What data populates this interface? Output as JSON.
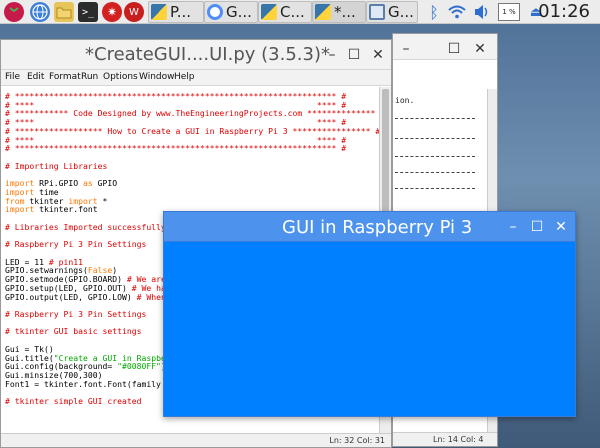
{
  "taskbar": {
    "clock": "01:26",
    "volume": "1 %",
    "buttons": [
      {
        "label": "P..."
      },
      {
        "label": "G..."
      },
      {
        "label": "C..."
      },
      {
        "label": "*..."
      },
      {
        "label": "G..."
      }
    ]
  },
  "editor": {
    "title": "*CreateGUI....UI.py (3.5.3)*",
    "menus": [
      "File",
      "Edit",
      "Format",
      "Run",
      "Options",
      "Window",
      "Help"
    ],
    "status": "Ln: 32   Col: 31",
    "code": [
      [
        {
          "t": "# ****************************************************************** #",
          "c": "cm"
        }
      ],
      [
        {
          "t": "# ****                                                          **** #",
          "c": "cm"
        }
      ],
      [
        {
          "t": "# *********** Code Designed by www.TheEngineeringProjects.com ************** #",
          "c": "cm"
        }
      ],
      [
        {
          "t": "# ****                                                          **** #",
          "c": "cm"
        }
      ],
      [
        {
          "t": "# ****************** How to Create a GUI in Raspberry Pi 3 **************** #",
          "c": "cm"
        }
      ],
      [
        {
          "t": "# ****                                                          **** #",
          "c": "cm"
        }
      ],
      [
        {
          "t": "# ****************************************************************** #",
          "c": "cm"
        }
      ],
      [],
      [
        {
          "t": "# Importing Libraries",
          "c": "cm"
        }
      ],
      [],
      [
        {
          "t": "import",
          "c": "kw"
        },
        {
          "t": " RPi.GPIO "
        },
        {
          "t": "as",
          "c": "kw"
        },
        {
          "t": " GPIO"
        }
      ],
      [
        {
          "t": "import",
          "c": "kw"
        },
        {
          "t": " time"
        }
      ],
      [
        {
          "t": "from",
          "c": "kw"
        },
        {
          "t": " tkinter "
        },
        {
          "t": "import",
          "c": "kw"
        },
        {
          "t": " *"
        }
      ],
      [
        {
          "t": "import",
          "c": "kw"
        },
        {
          "t": " tkinter.font"
        }
      ],
      [],
      [
        {
          "t": "# Libraries Imported successfully",
          "c": "cm"
        }
      ],
      [],
      [
        {
          "t": "# Raspberry Pi 3 Pin Settings",
          "c": "cm"
        }
      ],
      [],
      [
        {
          "t": "LED = 11 "
        },
        {
          "t": "# pin11",
          "c": "cm"
        }
      ],
      [
        {
          "t": "GPIO.setwarnings("
        },
        {
          "t": "False",
          "c": "kw"
        },
        {
          "t": ")"
        }
      ],
      [
        {
          "t": "GPIO.setmode(GPIO.BOARD) "
        },
        {
          "t": "# We are",
          "c": "cm"
        }
      ],
      [
        {
          "t": "GPIO.setup(LED, GPIO.OUT) "
        },
        {
          "t": "# We hav",
          "c": "cm"
        }
      ],
      [
        {
          "t": "GPIO.output(LED, GPIO.LOW) "
        },
        {
          "t": "# When",
          "c": "cm"
        }
      ],
      [],
      [
        {
          "t": "# Raspberry Pi 3 Pin Settings",
          "c": "cm"
        }
      ],
      [],
      [
        {
          "t": "# tkinter GUI basic settings",
          "c": "cm"
        }
      ],
      [],
      [
        {
          "t": "Gui = Tk()"
        }
      ],
      [
        {
          "t": "Gui.title("
        },
        {
          "t": "\"Create a GUI in Raspber",
          "c": "st"
        }
      ],
      [
        {
          "t": "Gui.config(background= "
        },
        {
          "t": "\"#0080FF\"",
          "c": "st"
        },
        {
          "t": ")"
        }
      ],
      [
        {
          "t": "Gui.minsize(700,300)"
        }
      ],
      [
        {
          "t": "Font1 = tkinter.font.Font(family ="
        }
      ],
      [],
      [
        {
          "t": "# tkinter simple GUI created",
          "c": "cm"
        }
      ]
    ]
  },
  "shell": {
    "text_line": "ion.",
    "status": "Ln: 14   Col: 4"
  },
  "gui": {
    "title": "GUI in Raspberry Pi 3",
    "background": "#0080FF"
  }
}
